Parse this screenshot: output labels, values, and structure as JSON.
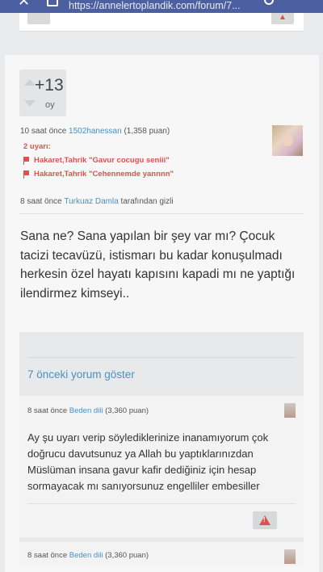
{
  "browser": {
    "url": "https://annelertoplandik.com/forum/7..."
  },
  "post": {
    "vote_score": "+13",
    "vote_label": "oy",
    "meta_time": "10 saat önce",
    "author": "1502hanessan",
    "points": "(1,358 puan)",
    "warnings_title": "2 uyarı:",
    "warnings": [
      "Hakaret,Tahrik \"Gavur cocugu seniii\"",
      "Hakaret,Tahrik \"Cehennemde yannnn\""
    ],
    "hidden_time": "8 saat önce",
    "hidden_by": "Turkuaz Damla",
    "hidden_suffix": "tarafından gizli",
    "body": "Sana ne? Sana  yapılan bir şey var mı? Çocuk tacizi tecavüzü, istismarı bu kadar konuşulmadı herkesin özel hayatı kapısını kapadi mı ne yaptığı ilendirmez kimseyi.."
  },
  "comments_section": {
    "show_more": "7 önceki yorum göster",
    "comments": [
      {
        "time": "8 saat önce",
        "author": "Beden dili",
        "points": "(3,360 puan)",
        "text": "Ay şu uyarı verip söylediklerinize inanamıyorum çok doğrucu davutsunuz ya Allah bu yaptıklarınızdan Müslüman insana gavur kafir dediğiniz için hesap sormayacak mı sanıyorsunuz engelliler embesiller"
      },
      {
        "time": "8 saat önce",
        "author": "Beden dili",
        "points": "(3,360 puan)"
      }
    ]
  }
}
